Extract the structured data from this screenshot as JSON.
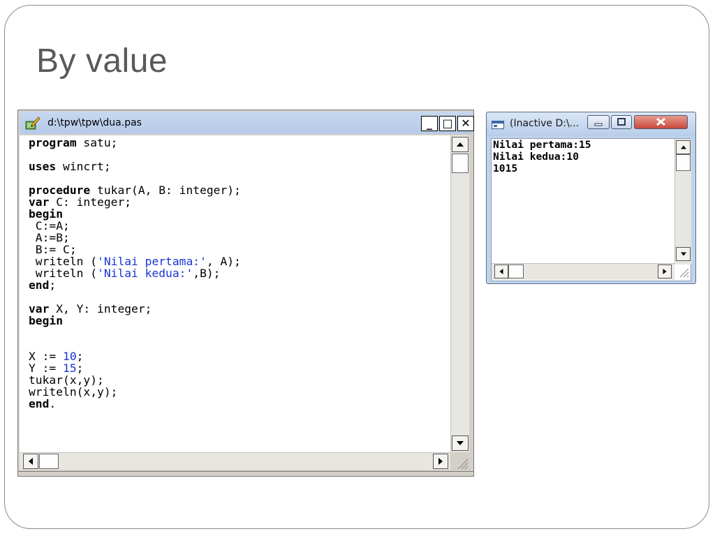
{
  "slide": {
    "title": "By value"
  },
  "editor": {
    "title": "d:\\tpw\\tpw\\dua.pas",
    "buttons": {
      "minimize": "_",
      "maximize": "□",
      "close": "✕"
    },
    "code_lines": [
      [
        {
          "t": "program",
          "k": "kw"
        },
        {
          "t": " satu;"
        }
      ],
      [],
      [
        {
          "t": "uses",
          "k": "kw"
        },
        {
          "t": " wincrt;"
        }
      ],
      [],
      [
        {
          "t": "procedure",
          "k": "kw"
        },
        {
          "t": " tukar(A, B: integer);"
        }
      ],
      [
        {
          "t": "var",
          "k": "kw"
        },
        {
          "t": " C: integer;"
        }
      ],
      [
        {
          "t": "begin",
          "k": "kw"
        }
      ],
      [
        {
          "t": " C:=A;"
        }
      ],
      [
        {
          "t": " A:=B;"
        }
      ],
      [
        {
          "t": " B:= C;"
        }
      ],
      [
        {
          "t": " writeln ("
        },
        {
          "t": "'Nilai pertama:'",
          "k": "str"
        },
        {
          "t": ", A);"
        }
      ],
      [
        {
          "t": " writeln ("
        },
        {
          "t": "'Nilai kedua:'",
          "k": "str"
        },
        {
          "t": ",B);"
        }
      ],
      [
        {
          "t": "end",
          "k": "kw"
        },
        {
          "t": ";"
        }
      ],
      [],
      [
        {
          "t": "var",
          "k": "kw"
        },
        {
          "t": " X, Y: integer;"
        }
      ],
      [
        {
          "t": "begin",
          "k": "kw"
        }
      ],
      [],
      [],
      [
        {
          "t": "X := "
        },
        {
          "t": "10",
          "k": "num"
        },
        {
          "t": ";"
        }
      ],
      [
        {
          "t": "Y := "
        },
        {
          "t": "15",
          "k": "num"
        },
        {
          "t": ";"
        }
      ],
      [
        {
          "t": "tukar(x,y);"
        }
      ],
      [
        {
          "t": "writeln(x,y);"
        }
      ],
      [
        {
          "t": "end",
          "k": "kw"
        },
        {
          "t": "."
        }
      ]
    ]
  },
  "output_window": {
    "title": "(Inactive D:\\...",
    "lines": [
      "Nilai pertama:15",
      "Nilai kedua:10",
      "1015"
    ]
  },
  "colors": {
    "keyword": "#000000",
    "string": "#1a35d6",
    "number": "#1a35d6",
    "close_red": "#c9483c"
  }
}
